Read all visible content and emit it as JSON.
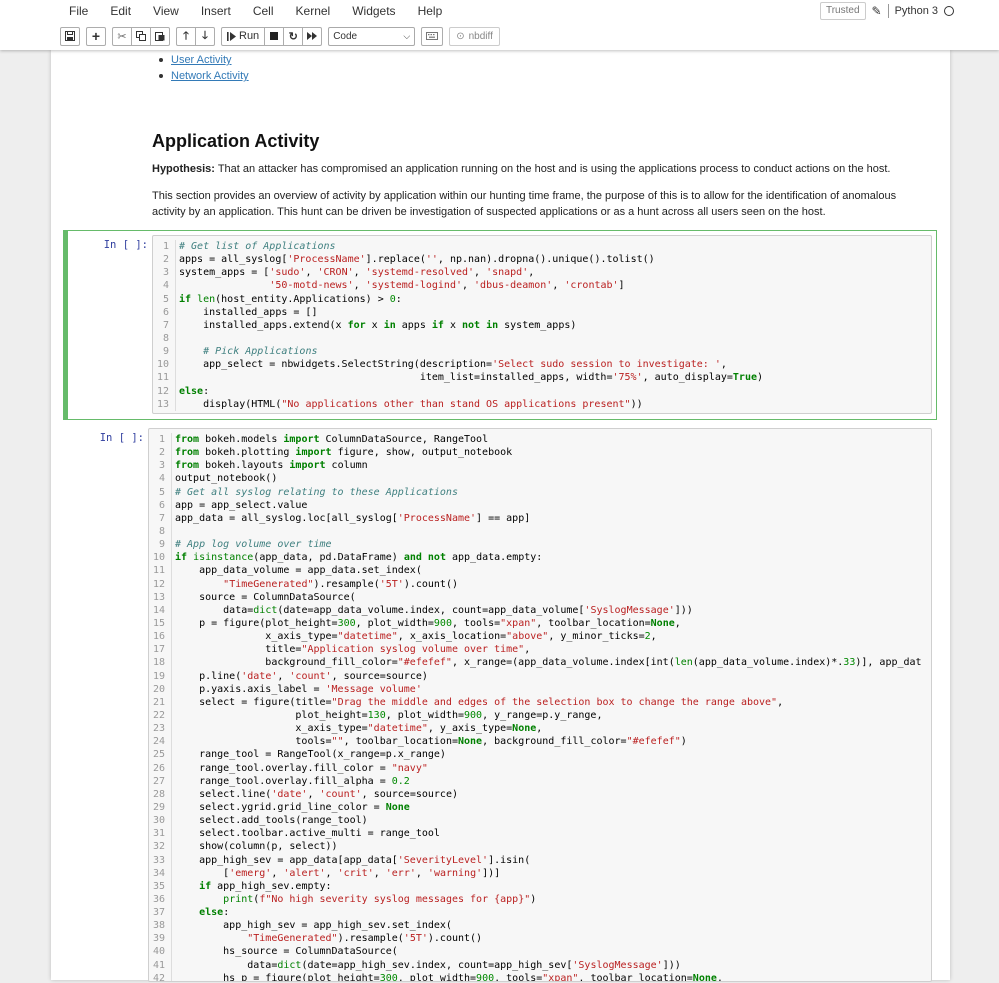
{
  "menubar": {
    "items": [
      "File",
      "Edit",
      "View",
      "Insert",
      "Cell",
      "Kernel",
      "Widgets",
      "Help"
    ]
  },
  "kernel": {
    "trusted": "Trusted",
    "name": "Python 3"
  },
  "toolbar": {
    "run_label": "Run",
    "cell_type": "Code",
    "nbdiff_label": "nbdiff",
    "icons": [
      "save-icon",
      "plus-icon",
      "cut-icon",
      "copy-icon",
      "paste-icon",
      "arrow-up-icon",
      "arrow-down-icon",
      "run-icon",
      "stop-icon",
      "restart-icon",
      "fast-forward-icon",
      "keyboard-icon",
      "nbdiff-icon"
    ]
  },
  "toc": {
    "links": [
      "User Activity",
      "Network Activity"
    ],
    "link_color": "#337ab7"
  },
  "section": {
    "heading": "Application Activity",
    "hypothesis_label": "Hypothesis:",
    "hypothesis_text": " That an attacker has compromised an application running on the host and is using the applications process to conduct actions on the host.",
    "overview_line1": "This section provides an overview of activity by application within our hunting time frame, the purpose of this is to allow for the identification of anomalous",
    "overview_line2": "activity by an application. This hunt can be driven be investigation of suspected applications or as a hunt across all users seen on the host."
  },
  "cells": [
    {
      "prompt": "In [ ]:",
      "selected": true,
      "lines": [
        "# Get list of Applications",
        "apps = all_syslog['ProcessName'].replace('', np.nan).dropna().unique().tolist()",
        "system_apps = ['sudo', 'CRON', 'systemd-resolved', 'snapd',",
        "               '50-motd-news', 'systemd-logind', 'dbus-deamon', 'crontab']",
        "if len(host_entity.Applications) > 0:",
        "    installed_apps = []",
        "    installed_apps.extend(x for x in apps if x not in system_apps)",
        "",
        "    # Pick Applications",
        "    app_select = nbwidgets.SelectString(description='Select sudo session to investigate: ',",
        "                                        item_list=installed_apps, width='75%', auto_display=True)",
        "else:",
        "    display(HTML(\"No applications other than stand OS applications present\"))"
      ]
    },
    {
      "prompt": "In [ ]:",
      "selected": false,
      "lines": [
        "from bokeh.models import ColumnDataSource, RangeTool",
        "from bokeh.plotting import figure, show, output_notebook",
        "from bokeh.layouts import column",
        "output_notebook()",
        "# Get all syslog relating to these Applications",
        "app = app_select.value",
        "app_data = all_syslog.loc[all_syslog['ProcessName'] == app]",
        "",
        "# App log volume over time",
        "if isinstance(app_data, pd.DataFrame) and not app_data.empty:",
        "    app_data_volume = app_data.set_index(",
        "        \"TimeGenerated\").resample('5T').count()",
        "    source = ColumnDataSource(",
        "        data=dict(date=app_data_volume.index, count=app_data_volume['SyslogMessage']))",
        "    p = figure(plot_height=300, plot_width=900, tools=\"xpan\", toolbar_location=None,",
        "               x_axis_type=\"datetime\", x_axis_location=\"above\", y_minor_ticks=2,",
        "               title=\"Application syslog volume over time\",",
        "               background_fill_color=\"#efefef\", x_range=(app_data_volume.index[int(len(app_data_volume.index)*.33)], app_dat",
        "    p.line('date', 'count', source=source)",
        "    p.yaxis.axis_label = 'Message volume'",
        "    select = figure(title=\"Drag the middle and edges of the selection box to change the range above\",",
        "                    plot_height=130, plot_width=900, y_range=p.y_range,",
        "                    x_axis_type=\"datetime\", y_axis_type=None,",
        "                    tools=\"\", toolbar_location=None, background_fill_color=\"#efefef\")",
        "    range_tool = RangeTool(x_range=p.x_range)",
        "    range_tool.overlay.fill_color = \"navy\"",
        "    range_tool.overlay.fill_alpha = 0.2",
        "    select.line('date', 'count', source=source)",
        "    select.ygrid.grid_line_color = None",
        "    select.add_tools(range_tool)",
        "    select.toolbar.active_multi = range_tool",
        "    show(column(p, select))",
        "    app_high_sev = app_data[app_data['SeverityLevel'].isin(",
        "        ['emerg', 'alert', 'crit', 'err', 'warning'])]",
        "    if app_high_sev.empty:",
        "        print(f\"No high severity syslog messages for {app}\")",
        "    else:",
        "        app_high_sev = app_high_sev.set_index(",
        "            \"TimeGenerated\").resample('5T').count()",
        "        hs_source = ColumnDataSource(",
        "            data=dict(date=app_high_sev.index, count=app_high_sev['SyslogMessage']))",
        "        hs_p = figure(plot_height=300, plot_width=900, tools=\"xpan\", toolbar_location=None,"
      ]
    }
  ]
}
